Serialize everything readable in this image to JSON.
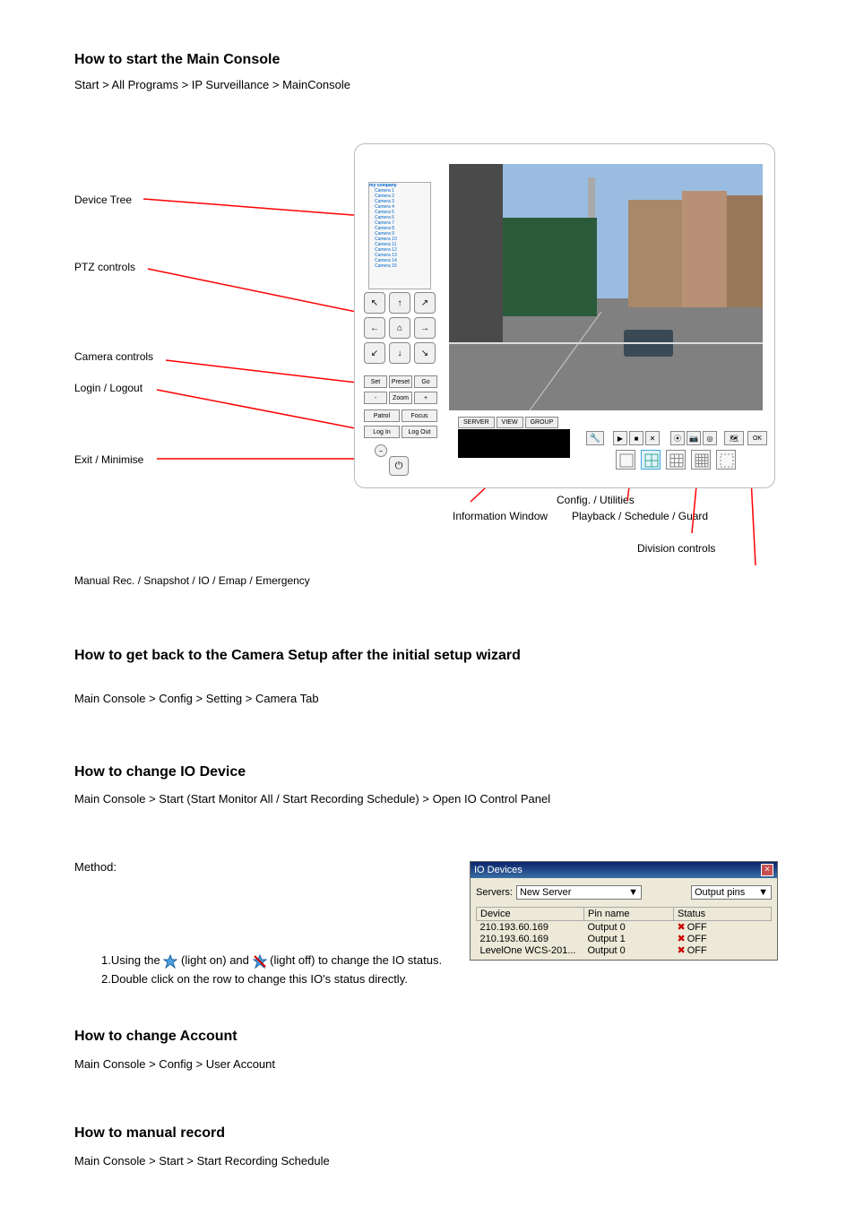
{
  "section1_title": "How to start the Main Console",
  "section1_text": "Start > All Programs > IP Surveillance > MainConsole",
  "annotations": {
    "device_tree": "Device Tree",
    "ptz_controls": "PTZ controls",
    "camera_controls": "Camera controls",
    "login_logout": "Login / Logout",
    "exit_minimise": "Exit / Minimise",
    "wrench": "Config. / Utilities",
    "information": "Information Window",
    "playback": "Playback / Schedule / Guard",
    "division": "Division controls",
    "manual_io": "Manual Rec. / Snapshot / IO / Emap / Emergency"
  },
  "device_tree": {
    "root": "my company",
    "cameras": [
      "Camera 1",
      "Camera 2",
      "Camera 3",
      "Camera 4",
      "Camera 5",
      "Camera 6",
      "Camera 7",
      "Camera 8",
      "Camera 9",
      "Camera 10",
      "Camera 11",
      "Camera 12",
      "Camera 13",
      "Camera 14",
      "Camera 15"
    ]
  },
  "ptz": {
    "nw": "↖",
    "n": "↑",
    "ne": "↗",
    "w": "←",
    "home_icon": "⌂",
    "e": "→",
    "sw": "↙",
    "s": "↓",
    "se": "↘"
  },
  "cam_controls": {
    "set": "Set",
    "preset": "Preset",
    "go": "Go",
    "minus": "-",
    "zoom": "Zoom",
    "plus": "+",
    "patrol": "Patrol",
    "focus": "Focus",
    "login": "Log In",
    "logout": "Log Out"
  },
  "tabs": {
    "server": "SERVER",
    "view": "VIEW",
    "group": "GROUP"
  },
  "ctrl_icons": {
    "wrench": "🔧",
    "play": "▶",
    "stop": "■",
    "close": "✕",
    "rec": "⦿",
    "snap": "📷",
    "io": "◎",
    "emap": "🗺",
    "ok": "OK"
  },
  "section2_title": "How to get back to the Camera Setup after the initial setup wizard",
  "section2_text": "Main Console > Config > Setting > Camera Tab",
  "section3_title": "How to change IO Device",
  "section3_text1": "Main Console > Start (Start Monitor All / Start Recording Schedule) > Open IO Control Panel",
  "section3_text2_1": "1.Using the ",
  "section3_text2_2": "(light on) and ",
  "section3_text2_3": "(light off) to change the IO status.",
  "section3_text2_4": "2.Double click on the row to change this IO's status directly.",
  "io_dialog": {
    "title": "IO Devices",
    "servers_label": "Servers:",
    "server_value": "New Server",
    "pins_value": "Output pins",
    "cols": {
      "device": "Device",
      "pin": "Pin name",
      "status": "Status"
    },
    "rows": [
      {
        "device": "210.193.60.169",
        "pin": "Output 0",
        "status": "OFF"
      },
      {
        "device": "210.193.60.169",
        "pin": "Output 1",
        "status": "OFF"
      },
      {
        "device": "LevelOne WCS-201...",
        "pin": "Output 0",
        "status": "OFF"
      }
    ]
  },
  "section4_title": "How to change Account",
  "section4_text": "Main Console > Config > User Account",
  "section5_title": "How to manual record",
  "section5_text": "Main Console > Start > Start Recording Schedule"
}
